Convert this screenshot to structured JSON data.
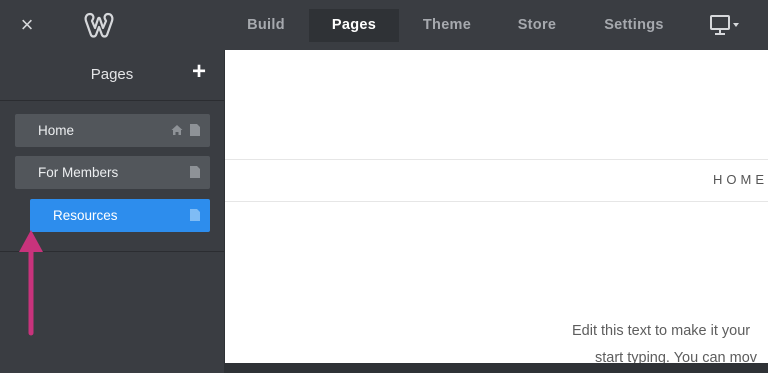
{
  "topbar": {
    "close_icon": "×",
    "logo": "weebly-logo-icon",
    "tabs": [
      {
        "label": "Build",
        "active": false
      },
      {
        "label": "Pages",
        "active": true
      },
      {
        "label": "Theme",
        "active": false
      },
      {
        "label": "Store",
        "active": false
      },
      {
        "label": "Settings",
        "active": false
      }
    ],
    "device_icon": "monitor-dropdown-icon"
  },
  "sidebar": {
    "title": "Pages",
    "add_icon": "+",
    "pages": [
      {
        "label": "Home",
        "icons": [
          "home-icon",
          "page-icon"
        ],
        "selected": false
      },
      {
        "label": "For Members",
        "icons": [
          "page-icon"
        ],
        "selected": false
      },
      {
        "label": "Resources",
        "icons": [
          "page-icon"
        ],
        "selected": true,
        "indent": 1
      }
    ]
  },
  "canvas": {
    "nav_home": "HOME",
    "body_text_line1": "Edit this text to make it your",
    "body_text_line2": "start typing. You can mov"
  },
  "colors": {
    "selected_page": "#2d8ded",
    "arrow": "#c8337c",
    "topbar": "#3a3d42"
  }
}
